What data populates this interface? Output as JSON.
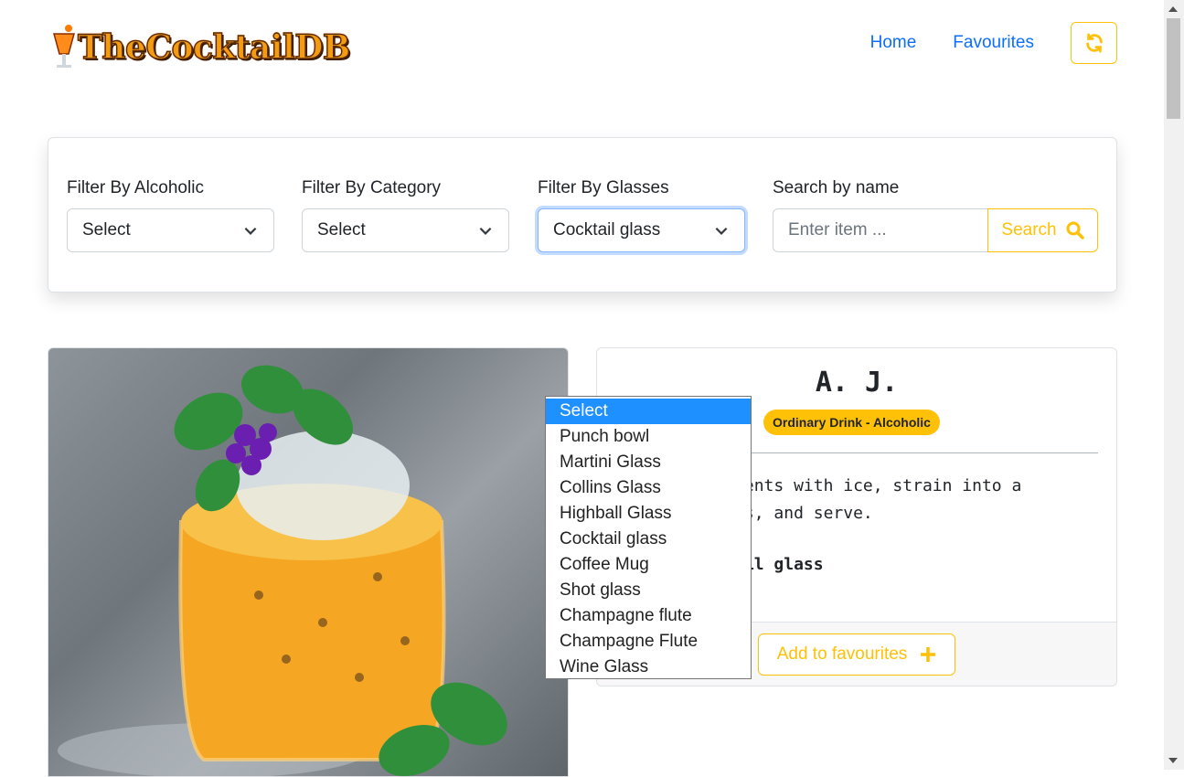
{
  "header": {
    "logo_text": "TheCocktailDB",
    "nav": [
      {
        "label": "Home"
      },
      {
        "label": "Favourites"
      }
    ],
    "refresh_icon": "refresh-icon"
  },
  "filters": {
    "alcoholic": {
      "label": "Filter By Alcoholic",
      "value": "Select"
    },
    "category": {
      "label": "Filter By Category",
      "value": "Select"
    },
    "glasses": {
      "label": "Filter By Glasses",
      "value": "Cocktail glass"
    },
    "search": {
      "label": "Search by name",
      "placeholder": "Enter item ...",
      "button_label": "Search"
    }
  },
  "glass_dropdown": {
    "options": [
      "Select",
      "Punch bowl",
      "Martini Glass",
      "Collins Glass",
      "Highball Glass",
      "Cocktail glass",
      "Coffee Mug",
      "Shot glass",
      "Champagne flute",
      "Champagne Flute",
      "Wine Glass"
    ],
    "highlighted": "Select"
  },
  "drink": {
    "name": "A. J.",
    "badge": "Ordinary Drink - Alcoholic",
    "instructions": "Shake ingredients with ice, strain into a cocktail glass, and serve.",
    "glass_line": "Glass: Cocktail glass",
    "fav_button": "Add to favourites"
  },
  "colors": {
    "accent": "#ffc107",
    "link": "#0d6efd",
    "highlight": "#1e90ff"
  }
}
